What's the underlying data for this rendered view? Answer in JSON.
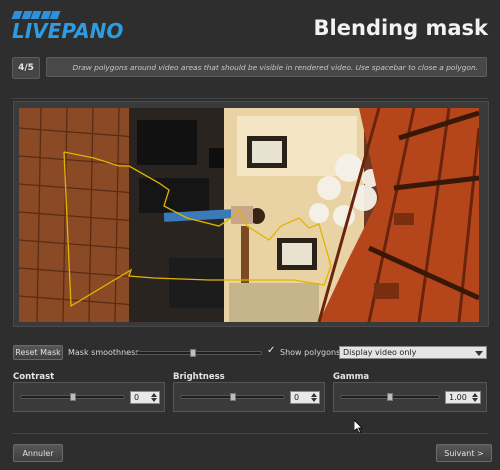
{
  "app": {
    "logo_text": "LIVEPANO",
    "title": "Blending mask"
  },
  "step": {
    "badge": "4/5",
    "instruction": "Draw polygons around video areas that should be visible in rendered video. Use spacebar to close a polygon."
  },
  "controls": {
    "reset_mask_label": "Reset Mask",
    "mask_smoothness_label": "Mask smoothness",
    "mask_smoothness_value": 0.45,
    "show_polygons_label": "Show polygons",
    "show_polygons_checked": true,
    "display_mode": "Display video only"
  },
  "adjustments": [
    {
      "label": "Contrast",
      "value": "0",
      "level": 0.5
    },
    {
      "label": "Brightness",
      "value": "0",
      "level": 0.5
    },
    {
      "label": "Gamma",
      "value": "1.00",
      "level": 0.5
    }
  ],
  "footer": {
    "cancel_label": "Annuler",
    "next_label": "Suivant >"
  },
  "colors": {
    "accent_blue": "#2f9be0",
    "polygon_yellow": "#e2b400"
  }
}
